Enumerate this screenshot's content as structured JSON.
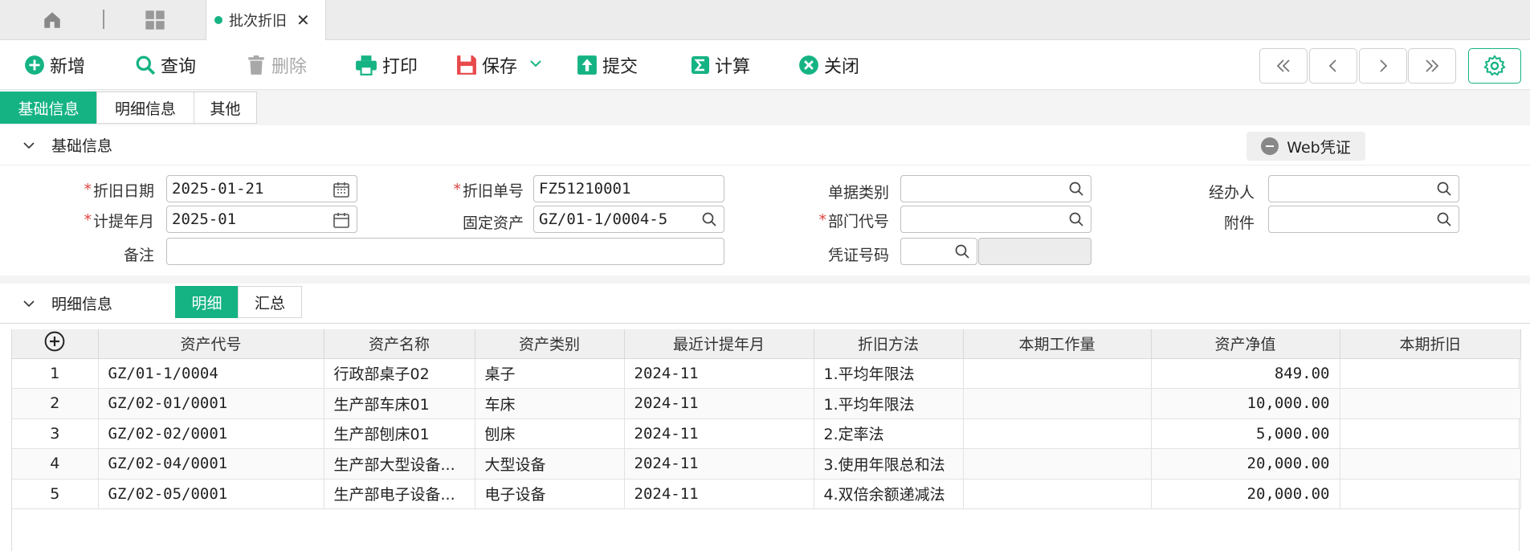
{
  "tabbar": {
    "active_tab": "批次折旧"
  },
  "toolbar": {
    "add": "新增",
    "query": "查询",
    "delete": "删除",
    "print": "打印",
    "save": "保存",
    "submit": "提交",
    "calc": "计算",
    "close": "关闭"
  },
  "section_tabs": [
    "基础信息",
    "明细信息",
    "其他"
  ],
  "basic": {
    "title": "基础信息",
    "web_voucher": "Web凭证",
    "fields": {
      "dep_date": {
        "label": "折旧日期",
        "value": "2025-01-21"
      },
      "dep_no": {
        "label": "折旧单号",
        "value": "FZ51210001"
      },
      "doc_type": {
        "label": "单据类别",
        "value": ""
      },
      "handler": {
        "label": "经办人",
        "value": ""
      },
      "accrual_month": {
        "label": "计提年月",
        "value": "2025-01"
      },
      "fixed_asset": {
        "label": "固定资产",
        "value": "GZ/01-1/0004-5"
      },
      "dept_code": {
        "label": "部门代号",
        "value": ""
      },
      "attachment": {
        "label": "附件",
        "value": ""
      },
      "remark": {
        "label": "备注",
        "value": ""
      },
      "voucher_no": {
        "label": "凭证号码",
        "value": ""
      }
    }
  },
  "detail": {
    "title": "明细信息",
    "tabs": [
      "明细",
      "汇总"
    ],
    "columns": [
      "资产代号",
      "资产名称",
      "资产类别",
      "最近计提年月",
      "折旧方法",
      "本期工作量",
      "资产净值",
      "本期折旧"
    ],
    "rows": [
      [
        "1",
        "GZ/01-1/0004",
        "行政部桌子02",
        "桌子",
        "2024-11",
        "1.平均年限法",
        "",
        "849.00",
        ""
      ],
      [
        "2",
        "GZ/02-01/0001",
        "生产部车床01",
        "车床",
        "2024-11",
        "1.平均年限法",
        "",
        "10,000.00",
        ""
      ],
      [
        "3",
        "GZ/02-02/0001",
        "生产部刨床01",
        "刨床",
        "2024-11",
        "2.定率法",
        "",
        "5,000.00",
        ""
      ],
      [
        "4",
        "GZ/02-04/0001",
        "生产部大型设备...",
        "大型设备",
        "2024-11",
        "3.使用年限总和法",
        "",
        "20,000.00",
        ""
      ],
      [
        "5",
        "GZ/02-05/0001",
        "生产部电子设备...",
        "电子设备",
        "2024-11",
        "4.双倍余额递减法",
        "",
        "20,000.00",
        ""
      ]
    ]
  },
  "colors": {
    "accent": "#15b384",
    "required": "#e0433f"
  }
}
